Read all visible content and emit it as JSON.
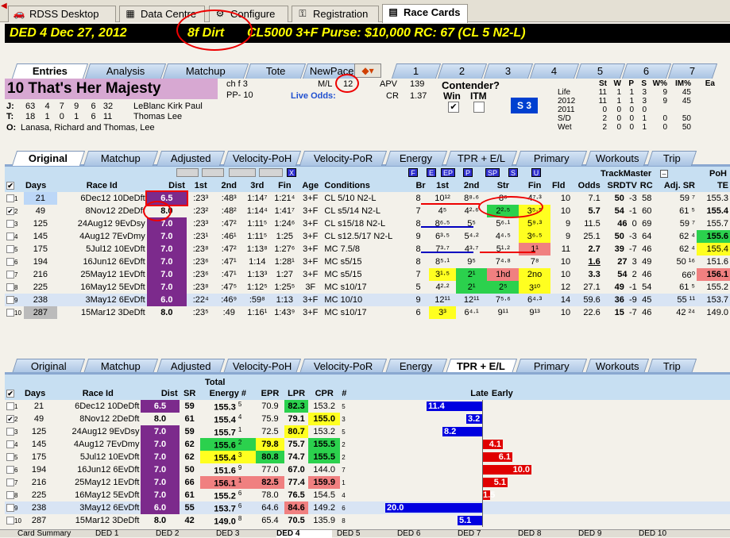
{
  "top_tabs": [
    {
      "label": "RDSS Desktop",
      "icon": "car-icon"
    },
    {
      "label": "Data Centre",
      "icon": "table-icon"
    },
    {
      "label": "Configure",
      "icon": "wrench-icon"
    },
    {
      "label": "Registration",
      "icon": "key-icon"
    },
    {
      "label": "Race Cards",
      "icon": "card-icon"
    }
  ],
  "header": {
    "race": "DED  4   Dec 27, 2012",
    "surface": "8f  Dirt",
    "cond": "CL5000  3+F   Purse: $10,000   RC: 67  (CL 5 N2-L)"
  },
  "entry_tabs": [
    "Entries",
    "Analysis",
    "Matchup",
    "Tote",
    "NewPace"
  ],
  "number_tabs": [
    "1",
    "2",
    "3",
    "4",
    "5",
    "6",
    "7"
  ],
  "horse": {
    "name": "10  That's Her Majesty",
    "sex": "ch f 3",
    "pp": "PP- 10",
    "ml_label": "M/L",
    "ml": "12",
    "live_odds": "Live Odds:",
    "apv_label": "APV",
    "apv": "139",
    "cr_label": "CR",
    "cr": "1.37",
    "contender": "Contender?",
    "win": "Win",
    "itm": "ITM",
    "s3": "S 3",
    "j_label": "J:",
    "j_stats": "63    4    7    9     6   32",
    "jockey": "LeBlanc Kirk Paul",
    "t_label": "T:",
    "t_stats": "18    1    0    1     6   11",
    "trainer": "Thomas Lee",
    "o_label": "O:",
    "owner": "Lanasa, Richard and Thomas, Lee"
  },
  "stats": {
    "headers": [
      "",
      "St",
      "W",
      "P",
      "S",
      "W%",
      "IM%",
      "Ea"
    ],
    "rows": [
      [
        "Life",
        "11",
        "1",
        "1",
        "3",
        "9",
        "45"
      ],
      [
        "2012",
        "11",
        "1",
        "1",
        "3",
        "9",
        "45"
      ],
      [
        "2011",
        "0",
        "0",
        "0",
        "0",
        "",
        ""
      ],
      [
        "S/D",
        "2",
        "0",
        "0",
        "1",
        "0",
        "50"
      ],
      [
        "Wet",
        "2",
        "0",
        "0",
        "1",
        "0",
        "50"
      ]
    ]
  },
  "pp_tabs": [
    "Original",
    "Matchup",
    "Adjusted",
    "Velocity-PoH",
    "Velocity-PoR",
    "Energy",
    "TPR + E/L",
    "Primary",
    "Workouts",
    "Trip"
  ],
  "pp_headers": {
    "days": "Days",
    "race_id": "Race Id",
    "dist": "Dist",
    "c1": "1st",
    "c2": "2nd",
    "c3": "3rd",
    "fin": "Fin",
    "age": "Age",
    "cond": "Conditions",
    "br": "Br",
    "p1": "1st",
    "p2": "2nd",
    "str": "Str",
    "pfin": "Fin",
    "fld": "Fld",
    "odds": "Odds",
    "tm": "TrackMaster",
    "srdtv": "SRDTV",
    "rc": "RC",
    "adjsr": "Adj. SR",
    "poh": "PoH",
    "te": "TE"
  },
  "pp_rows": [
    {
      "n": "1",
      "days": "21",
      "ri": "6Dec12 10DeD",
      "sf": "ft",
      "dist": "6.5",
      "t1": ":23³",
      "t2": ":48³",
      "t3": "1:14⁷",
      "fin": "1:21⁴",
      "age": "3+F",
      "cond": "CL 5/10 N2-L",
      "br": "8",
      "p1": "10¹²",
      "p2": "8⁸·⁶",
      "str": "8⁶",
      "pfin": "4⁷·³",
      "fld": "10",
      "odds": "7.1",
      "sr": "50",
      "dtv": "-3",
      "rc": "58",
      "adj": "59 ⁷",
      "te": "155.3"
    },
    {
      "n": "2",
      "days": "49",
      "ri": "8Nov12  2DeD",
      "sf": "ft",
      "dist": "8.0",
      "t1": ":23²",
      "t2": ":48²",
      "t3": "1:14⁴",
      "fin": "1:41⁷",
      "age": "3+F",
      "cond": "CL s5/14 N2-L",
      "br": "7",
      "p1": "4⁵",
      "p2": "4²·⁶",
      "str": "2²·⁵",
      "pfin": "3⁵·⁵",
      "fld": "10",
      "odds": "5.7",
      "sr": "54",
      "dtv": "-1",
      "rc": "60",
      "adj": "61 ⁵",
      "te": "155.4"
    },
    {
      "n": "3",
      "days": "125",
      "ri": "24Aug12  9EvD",
      "sf": "sy",
      "dist": "7.0",
      "t1": ":23³",
      "t2": ":47²",
      "t3": "1:11⁵",
      "fin": "1:24⁶",
      "age": "3+F",
      "cond": "CL s15/18 N2-L",
      "br": "8",
      "p1": "8⁶·⁵",
      "p2": "5⁵",
      "str": "5⁶·¹",
      "pfin": "5⁹·³",
      "fld": "9",
      "odds": "11.5",
      "sr": "46",
      "dtv": "0",
      "rc": "69",
      "adj": "59 ⁷",
      "te": "155.7"
    },
    {
      "n": "4",
      "days": "145",
      "ri": "4Aug12  7EvD",
      "sf": "my",
      "dist": "7.0",
      "t1": ":23¹",
      "t2": ":46¹",
      "t3": "1:11⁵",
      "fin": "1:25",
      "age": "3+F",
      "cond": "CL s12.5/17 N2-L",
      "br": "9",
      "p1": "6³·⁵",
      "p2": "5⁴·²",
      "str": "4⁴·⁵",
      "pfin": "3⁶·⁵",
      "fld": "9",
      "odds": "25.1",
      "sr": "50",
      "dtv": "-3",
      "rc": "64",
      "adj": "62 ⁴",
      "te": "155.6"
    },
    {
      "n": "5",
      "days": "175",
      "ri": "5Jul12 10EvD",
      "sf": "ft",
      "dist": "7.0",
      "t1": ":23⁸",
      "t2": ":47²",
      "t3": "1:13⁸",
      "fin": "1:27⁶",
      "age": "3+F",
      "cond": "MC 7.5/8",
      "br": "8",
      "p1": "7³·⁷",
      "p2": "4³·⁷",
      "str": "5¹·²",
      "pfin": "1¹",
      "fld": "11",
      "odds": "2.7",
      "sr": "39",
      "dtv": "-7",
      "rc": "46",
      "adj": "62 ⁴",
      "te": "155.4"
    },
    {
      "n": "6",
      "days": "194",
      "ri": "16Jun12  6EvD",
      "sf": "ft",
      "dist": "7.0",
      "t1": ":23⁶",
      "t2": ":47¹",
      "t3": "1:14",
      "fin": "1:28¹",
      "age": "3+F",
      "cond": "MC s5/15",
      "br": "8",
      "p1": "8⁵·¹",
      "p2": "9⁵",
      "str": "7⁴·⁸",
      "pfin": "7⁸",
      "fld": "10",
      "odds": "1.6",
      "sr": "27",
      "dtv": "3",
      "rc": "49",
      "adj": "50 ¹⁶",
      "te": "151.6"
    },
    {
      "n": "7",
      "days": "216",
      "ri": "25May12  1EvD",
      "sf": "ft",
      "dist": "7.0",
      "t1": ":23⁶",
      "t2": ":47¹",
      "t3": "1:13³",
      "fin": "1:27",
      "age": "3+F",
      "cond": "MC s5/15",
      "br": "7",
      "p1": "3¹·⁵",
      "p2": "2¹",
      "str": "1hd",
      "pfin": "2no",
      "fld": "10",
      "odds": "3.3",
      "sr": "54",
      "dtv": "2",
      "rc": "46",
      "adj": "66⁰",
      "te": "156.1"
    },
    {
      "n": "8",
      "days": "225",
      "ri": "16May12  5EvD",
      "sf": "ft",
      "dist": "7.0",
      "t1": ":23⁸",
      "t2": ":47⁵",
      "t3": "1:12⁵",
      "fin": "1:25⁵",
      "age": "3F",
      "cond": "MC s10/17",
      "br": "5",
      "p1": "4²·²",
      "p2": "2¹",
      "str": "2⁵",
      "pfin": "3¹⁰",
      "fld": "12",
      "odds": "27.1",
      "sr": "49",
      "dtv": "-1",
      "rc": "54",
      "adj": "61 ⁵",
      "te": "155.2"
    },
    {
      "n": "9",
      "days": "238",
      "ri": "3May12  6EvD",
      "sf": "ft",
      "dist": "6.0",
      "t1": ":22⁴",
      "t2": ":46⁹",
      "t3": ":59⁸",
      "fin": "1:13",
      "age": "3+F",
      "cond": "MC 10/10",
      "br": "9",
      "p1": "12¹¹",
      "p2": "12¹¹",
      "str": "7⁵·⁶",
      "pfin": "6⁴·³",
      "fld": "14",
      "odds": "59.6",
      "sr": "36",
      "dtv": "-9",
      "rc": "45",
      "adj": "55 ¹¹",
      "te": "153.7"
    },
    {
      "n": "10",
      "days": "287",
      "ri": "15Mar12  3DeD",
      "sf": "ft",
      "dist": "8.0",
      "t1": ":23⁵",
      "t2": ":49",
      "t3": "1:16¹",
      "fin": "1:43⁹",
      "age": "3+F",
      "cond": "MC s10/17",
      "br": "6",
      "p1": "3³",
      "p2": "6⁴·¹",
      "str": "9¹¹",
      "pfin": "9¹³",
      "fld": "10",
      "odds": "22.6",
      "sr": "15",
      "dtv": "-7",
      "rc": "46",
      "adj": "42 ²⁴",
      "te": "149.0"
    }
  ],
  "energy_headers": {
    "days": "Days",
    "race_id": "Race Id",
    "dist": "Dist",
    "sr": "SR",
    "total": "Total",
    "energy": "Energy #",
    "epr": "EPR",
    "lpr": "LPR",
    "cpr": "CPR",
    "hash": "#",
    "late": "Late",
    "early": "Early"
  },
  "energy_rows": [
    {
      "n": "1",
      "days": "21",
      "ri": "6Dec12 10DeD",
      "sf": "ft",
      "dist": "6.5",
      "sr": "59",
      "te": "155.3",
      "tr": "5",
      "epr": "70.9",
      "lpr": "82.3",
      "cpr": "153.2",
      "cr": "5",
      "bar": "11.4",
      "side": "late"
    },
    {
      "n": "2",
      "days": "49",
      "ri": "8Nov12  2DeD",
      "sf": "ft",
      "dist": "8.0",
      "sr": "61",
      "te": "155.4",
      "tr": "4",
      "epr": "75.9",
      "lpr": "79.1",
      "cpr": "155.0",
      "cr": "3",
      "bar": "3.2",
      "side": "late"
    },
    {
      "n": "3",
      "days": "125",
      "ri": "24Aug12  9EvD",
      "sf": "sy",
      "dist": "7.0",
      "sr": "59",
      "te": "155.7",
      "tr": "1",
      "epr": "72.5",
      "lpr": "80.7",
      "cpr": "153.2",
      "cr": "5",
      "bar": "8.2",
      "side": "late"
    },
    {
      "n": "4",
      "days": "145",
      "ri": "4Aug12  7EvD",
      "sf": "my",
      "dist": "7.0",
      "sr": "62",
      "te": "155.6",
      "tr": "2",
      "epr": "79.8",
      "lpr": "75.7",
      "cpr": "155.5",
      "cr": "2",
      "bar": "4.1",
      "side": "early"
    },
    {
      "n": "5",
      "days": "175",
      "ri": "5Jul12 10EvD",
      "sf": "ft",
      "dist": "7.0",
      "sr": "62",
      "te": "155.4",
      "tr": "3",
      "epr": "80.8",
      "lpr": "74.7",
      "cpr": "155.5",
      "cr": "2",
      "bar": "6.1",
      "side": "early"
    },
    {
      "n": "6",
      "days": "194",
      "ri": "16Jun12  6EvD",
      "sf": "ft",
      "dist": "7.0",
      "sr": "50",
      "te": "151.6",
      "tr": "9",
      "epr": "77.0",
      "lpr": "67.0",
      "cpr": "144.0",
      "cr": "7",
      "bar": "10.0",
      "side": "early"
    },
    {
      "n": "7",
      "days": "216",
      "ri": "25May12  1EvD",
      "sf": "ft",
      "dist": "7.0",
      "sr": "66",
      "te": "156.1",
      "tr": "1",
      "epr": "82.5",
      "lpr": "77.4",
      "cpr": "159.9",
      "cr": "1",
      "bar": "5.1",
      "side": "early"
    },
    {
      "n": "8",
      "days": "225",
      "ri": "16May12  5EvD",
      "sf": "ft",
      "dist": "7.0",
      "sr": "61",
      "te": "155.2",
      "tr": "6",
      "epr": "78.0",
      "lpr": "76.5",
      "cpr": "154.5",
      "cr": "4",
      "bar": "1.5",
      "side": "early"
    },
    {
      "n": "9",
      "days": "238",
      "ri": "3May12  6EvD",
      "sf": "ft",
      "dist": "6.0",
      "sr": "55",
      "te": "153.7",
      "tr": "6",
      "epr": "64.6",
      "lpr": "84.6",
      "cpr": "149.2",
      "cr": "6",
      "bar": "20.0",
      "side": "late"
    },
    {
      "n": "10",
      "days": "287",
      "ri": "15Mar12  3DeD",
      "sf": "ft",
      "dist": "8.0",
      "sr": "42",
      "te": "149.0",
      "tr": "8",
      "epr": "65.4",
      "lpr": "70.5",
      "cpr": "135.9",
      "cr": "8",
      "bar": "5.1",
      "side": "late"
    }
  ],
  "bottom_tabs": [
    "Card Summary",
    "DED 1",
    "DED 2",
    "DED 3",
    "DED 4",
    "DED 5",
    "DED 6",
    "DED 7",
    "DED 8",
    "DED 9",
    "DED 10"
  ],
  "colors": {
    "header_bg": "#000000",
    "header_text": "#ffff00",
    "dist_purple": "#7c2a8c",
    "green": "#2bd14d",
    "yellow": "#ffff20",
    "red_cell": "#f08080",
    "bar_blue": "#0000e0",
    "bar_red": "#e00000"
  }
}
